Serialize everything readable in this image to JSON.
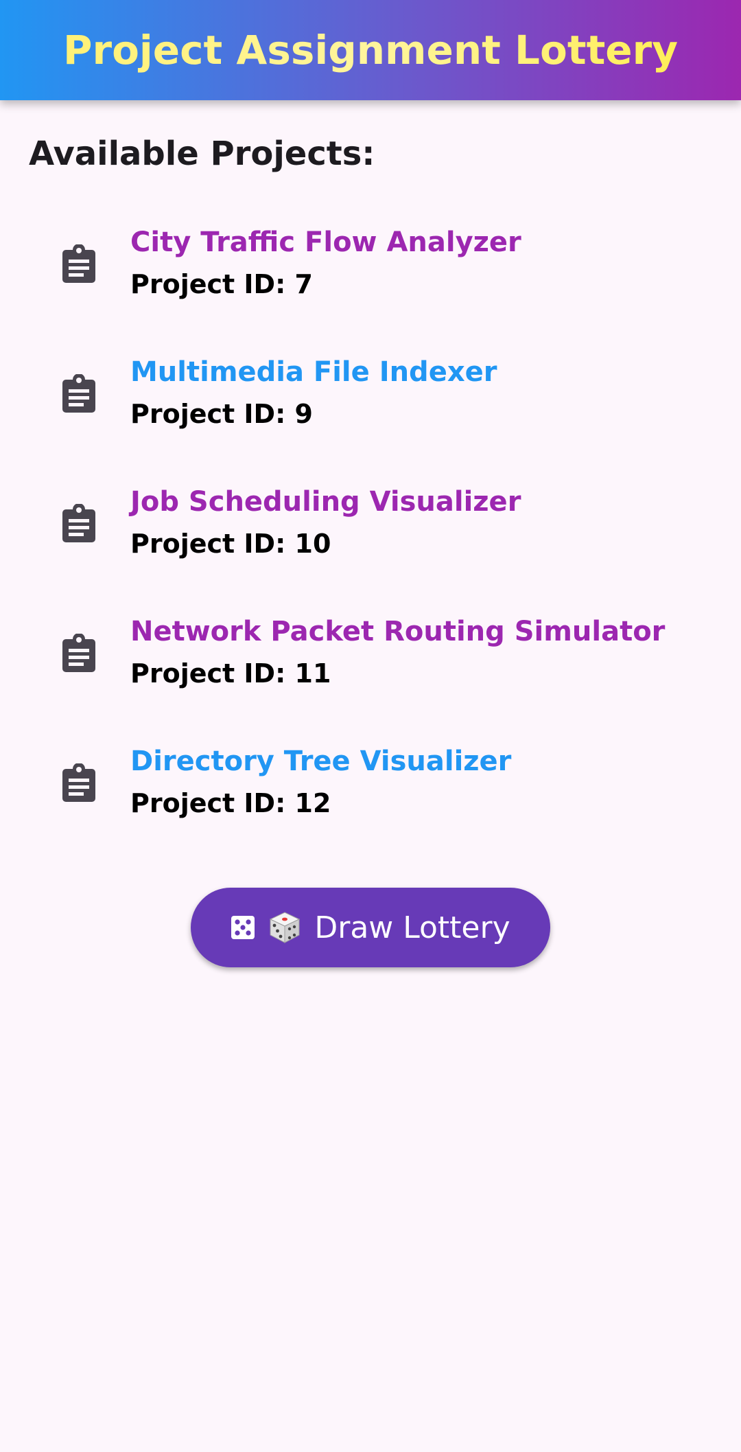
{
  "app_bar": {
    "title": "Project Assignment Lottery"
  },
  "section_heading": "Available Projects:",
  "projects": [
    {
      "title": "City Traffic Flow Analyzer",
      "id_text": "Project ID: 7",
      "title_color": "#9c27b0",
      "icon": "clipboard-icon"
    },
    {
      "title": "Multimedia File Indexer",
      "id_text": "Project ID: 9",
      "title_color": "#2196f3",
      "icon": "clipboard-icon"
    },
    {
      "title": "Job Scheduling Visualizer",
      "id_text": "Project ID: 10",
      "title_color": "#9c27b0",
      "icon": "clipboard-icon"
    },
    {
      "title": "Network Packet Routing Simulator",
      "id_text": "Project ID: 11",
      "title_color": "#9c27b0",
      "icon": "clipboard-icon"
    },
    {
      "title": "Directory Tree Visualizer",
      "id_text": "Project ID: 12",
      "title_color": "#2196f3",
      "icon": "clipboard-icon"
    }
  ],
  "draw_button": {
    "label": "Draw Lottery",
    "icon": "dice-icon",
    "emoji": "game-die-icon"
  },
  "colors": {
    "app_bar_gradient_start": "#2196f3",
    "app_bar_gradient_end": "#9c27b0",
    "title_text": "#fff176",
    "button_background": "#673ab7",
    "page_background": "#fdf6fc"
  }
}
